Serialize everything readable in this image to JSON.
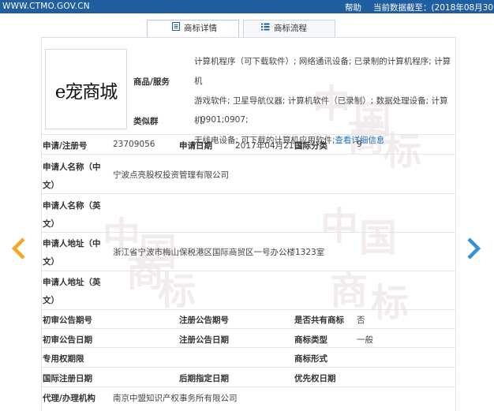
{
  "header": {
    "site": "WWW.CTMO.GOV.CN",
    "help": "帮助",
    "data_date": "当前数据截至：(2018年08月30"
  },
  "tabs": [
    {
      "label": "商标详情",
      "active": true,
      "icon": "document-list-icon"
    },
    {
      "label": "商标流程",
      "active": false,
      "icon": "process-list-icon"
    }
  ],
  "mark_image_text": "e宠商城",
  "goods": {
    "label": "商品/服务",
    "lines": [
      "计算机程序（可下载软件）; 网络通讯设备; 已录制的计算机程序; 计算机",
      "游戏软件; 卫星导航仪器; 计算机软件（已录制）; 数据处理设备; 计算机;",
      "无线电设备; 可下载的计算机应用软件;"
    ],
    "more_link": "查看详细信息"
  },
  "similar_group": {
    "label": "类似群",
    "value": "0901;0907;"
  },
  "fields": {
    "reg_no_label": "申请/注册号",
    "reg_no": "23709056",
    "app_date_label": "申请日期",
    "app_date": "2017年04月21日",
    "intl_class_label": "国际分类",
    "intl_class": "9",
    "applicant_cn_label_1": "申请人名称（中",
    "applicant_cn_label_2": "文）",
    "applicant_cn": "宁波点亮股权投资管理有限公司",
    "applicant_en_label_1": "申请人名称（英",
    "applicant_en_label_2": "文）",
    "address_cn_label_1": "申请人地址（中",
    "address_cn_label_2": "文）",
    "address_cn": "浙江省宁波市梅山保税港区国际商贸区一号办公楼1323室",
    "address_en_label_1": "申请人地址（英",
    "address_en_label_2": "文）",
    "prelim_pub_no_label": "初审公告期号",
    "reg_pub_no_label": "注册公告期号",
    "shared_label": "是否共有商标",
    "shared": "否",
    "prelim_pub_date_label": "初审公告日期",
    "reg_pub_date_label": "注册公告日期",
    "mark_type_label": "商标类型",
    "mark_type": "一般",
    "exclusive_period_label": "专用权期限",
    "mark_form_label": "商标形式",
    "intl_reg_date_label": "国际注册日期",
    "later_designation_label": "后期指定日期",
    "priority_date_label": "优先权日期",
    "agent_label": "代理/办理机构",
    "agent": "南京中盟知识产权事务所有限公司"
  },
  "watermark_chars": [
    "中",
    "国",
    "商",
    "标",
    "中",
    "国",
    "商",
    "标",
    "中",
    "国",
    "商",
    "标"
  ],
  "colors": {
    "header_bg": "#1f5e9f",
    "link": "#1d6fb8",
    "prev_arrow": "#f5a623",
    "next_arrow": "#3a8fd6"
  }
}
